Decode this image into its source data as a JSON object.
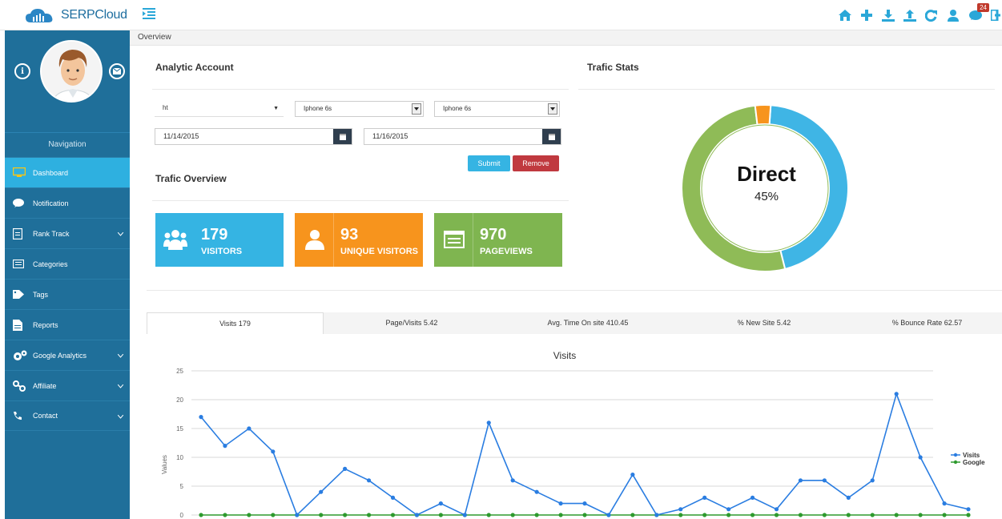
{
  "app": {
    "logo_text": "SERPCloud"
  },
  "topbar": {
    "message_count": "24",
    "icons": [
      "home-icon",
      "plus-icon",
      "download-icon",
      "upload-icon",
      "refresh-icon",
      "user-icon",
      "chat-icon",
      "logout-icon"
    ]
  },
  "breadcrumb": "Overview",
  "sidebar": {
    "nav_title": "Navigation",
    "items": [
      {
        "label": "Dashboard",
        "icon": "monitor-icon",
        "active": true
      },
      {
        "label": "Notification",
        "icon": "chat-icon"
      },
      {
        "label": "Rank Track",
        "icon": "file-icon",
        "submenu": true
      },
      {
        "label": "Categories",
        "icon": "list-icon"
      },
      {
        "label": "Tags",
        "icon": "tags-icon"
      },
      {
        "label": "Reports",
        "icon": "report-icon"
      },
      {
        "label": "Google Analytics",
        "icon": "cogs-icon",
        "submenu": true
      },
      {
        "label": "Affiliate",
        "icon": "link-icon",
        "submenu": true
      },
      {
        "label": "Contact",
        "icon": "phone-icon",
        "submenu": true
      }
    ]
  },
  "analytic": {
    "title": "Analytic Account",
    "account_select": "ht",
    "device_select_1": "Iphone 6s",
    "device_select_2": "Iphone 6s",
    "date_from": "11/14/2015",
    "date_to": "11/16/2015",
    "submit_label": "Submit",
    "remove_label": "Remove"
  },
  "overview": {
    "title": "Trafic Overview",
    "stats": [
      {
        "value": "179",
        "label": "VISITORS",
        "color": "#35b4e3"
      },
      {
        "value": "93",
        "label": "UNIQUE VISITORS",
        "color": "#f7941d"
      },
      {
        "value": "970",
        "label": "PAGEVIEWS",
        "color": "#7fb550"
      }
    ]
  },
  "trafic_stats": {
    "title": "Trafic Stats",
    "center_label": "Direct",
    "center_value": "45%",
    "slices": [
      {
        "value": 45,
        "color": "#3fb5e5"
      },
      {
        "value": 52,
        "color": "#8fbb57"
      },
      {
        "value": 3,
        "color": "#f7941d"
      }
    ]
  },
  "tabs": [
    {
      "label": "Visits 179",
      "active": true
    },
    {
      "label": "Page/Visits 5.42"
    },
    {
      "label": "Avg. Time On site 410.45"
    },
    {
      "label": "% New Site 5.42"
    },
    {
      "label": "% Bounce Rate 62.57"
    }
  ],
  "chart_data": {
    "type": "line",
    "title": "Visits",
    "ylabel": "Values",
    "ylim": [
      0,
      25
    ],
    "yticks": [
      0,
      5,
      10,
      15,
      20,
      25
    ],
    "grid": true,
    "legend_position": "right",
    "series": [
      {
        "name": "Visits",
        "color": "#2a7de1",
        "values": [
          17,
          12,
          15,
          11,
          0,
          4,
          8,
          6,
          3,
          0,
          2,
          0,
          16,
          6,
          4,
          2,
          2,
          0,
          7,
          0,
          1,
          3,
          1,
          3,
          1,
          6,
          6,
          3,
          6,
          21,
          10,
          2,
          1
        ]
      },
      {
        "name": "Google",
        "color": "#2e9a2e",
        "values": [
          0,
          0,
          0,
          0,
          0,
          0,
          0,
          0,
          0,
          0,
          0,
          0,
          0,
          0,
          0,
          0,
          0,
          0,
          0,
          0,
          0,
          0,
          0,
          0,
          0,
          0,
          0,
          0,
          0,
          0,
          0,
          0,
          0
        ]
      }
    ]
  }
}
